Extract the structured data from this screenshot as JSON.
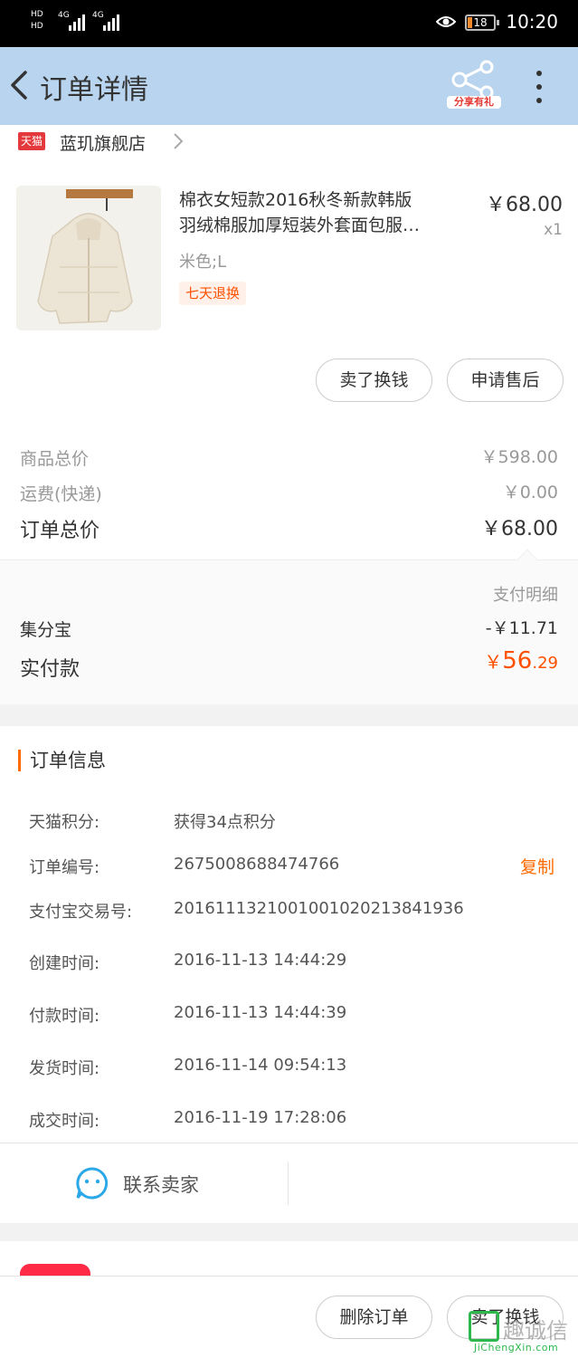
{
  "status_bar": {
    "network_1": "4G",
    "network_2": "4G",
    "battery": "18",
    "time": "10:20"
  },
  "header": {
    "title": "订单详情",
    "share_label": "分享有礼"
  },
  "shop": {
    "badge": "天猫",
    "name": "蓝玑旗舰店"
  },
  "product": {
    "title_line1": "棉衣女短款2016秋冬新款韩版",
    "title_line2": "羽绒棉服加厚短装外套面包服…",
    "price": "￥68.00",
    "quantity": "x1",
    "spec": "米色;L",
    "tag": "七天退换"
  },
  "actions": {
    "sell": "卖了换钱",
    "after_sale": "申请售后",
    "delete": "删除订单",
    "sell_bottom": "卖了换钱"
  },
  "totals": {
    "goods_label": "商品总价",
    "goods_value": "￥598.00",
    "shipping_label": "运费(快递)",
    "shipping_value": "￥0.00",
    "order_total_label": "订单总价",
    "order_total_value": "￥68.00"
  },
  "payment": {
    "detail_label": "支付明细",
    "jifenbao_label": "集分宝",
    "jifenbao_value": "-￥11.71",
    "paid_label": "实付款",
    "paid_currency": "￥",
    "paid_int": "56",
    "paid_dec": ".29"
  },
  "order_info": {
    "heading": "订单信息",
    "copy_label": "复制",
    "rows": [
      {
        "key": "天猫积分:",
        "value": "获得34点积分"
      },
      {
        "key": "订单编号:",
        "value": "2675008688474766"
      },
      {
        "key": "支付宝交易号:",
        "value": "2016111321001001020213841936"
      },
      {
        "key": "创建时间:",
        "value": "2016-11-13 14:44:29"
      },
      {
        "key": "付款时间:",
        "value": "2016-11-13 14:44:39"
      },
      {
        "key": "发货时间:",
        "value": "2016-11-14 09:54:13"
      },
      {
        "key": "成交时间:",
        "value": "2016-11-19 17:28:06"
      }
    ]
  },
  "contact": {
    "label": "联系卖家"
  },
  "watermark": {
    "text": "趣诚信",
    "sub": "JiChengXin.com"
  },
  "colors": {
    "header_bg": "#b9d4ee",
    "accent": "#ff5000",
    "tmall_red": "#e4393c"
  }
}
